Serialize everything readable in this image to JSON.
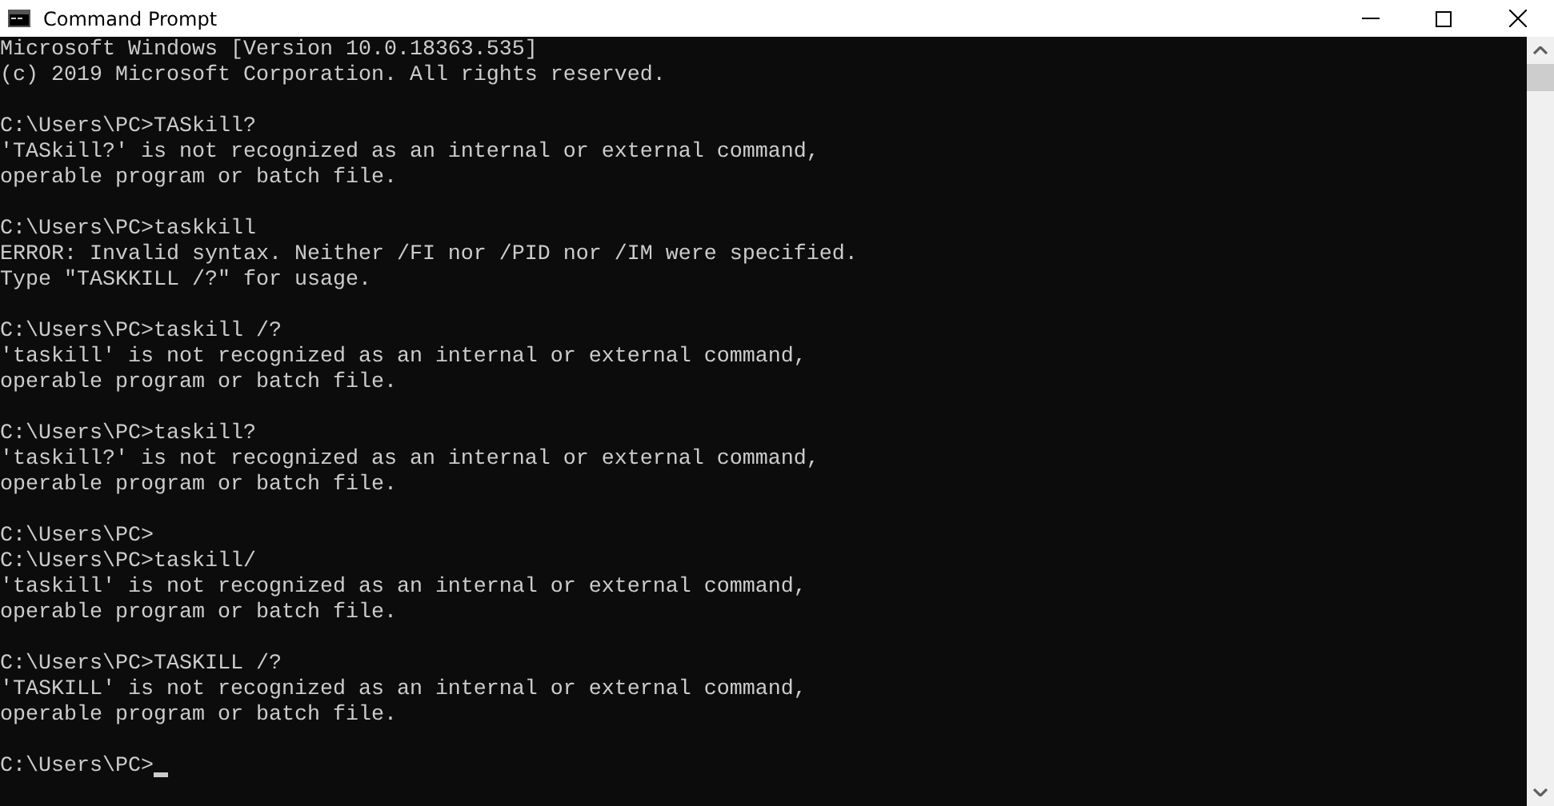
{
  "window": {
    "title": "Command Prompt"
  },
  "console": {
    "blocks": [
      [
        "Microsoft Windows [Version 10.0.18363.535]",
        "(c) 2019 Microsoft Corporation. All rights reserved."
      ],
      [
        "C:\\Users\\PC>TASkill?",
        "'TASkill?' is not recognized as an internal or external command,",
        "operable program or batch file."
      ],
      [
        "C:\\Users\\PC>taskkill",
        "ERROR: Invalid syntax. Neither /FI nor /PID nor /IM were specified.",
        "Type \"TASKKILL /?\" for usage."
      ],
      [
        "C:\\Users\\PC>taskill /?",
        "'taskill' is not recognized as an internal or external command,",
        "operable program or batch file."
      ],
      [
        "C:\\Users\\PC>taskill?",
        "'taskill?' is not recognized as an internal or external command,",
        "operable program or batch file."
      ],
      [
        "C:\\Users\\PC>",
        "C:\\Users\\PC>taskill/",
        "'taskill' is not recognized as an internal or external command,",
        "operable program or batch file."
      ],
      [
        "C:\\Users\\PC>TASKILL /?",
        "'TASKILL' is not recognized as an internal or external command,",
        "operable program or batch file."
      ],
      [
        "C:\\Users\\PC>"
      ]
    ]
  }
}
